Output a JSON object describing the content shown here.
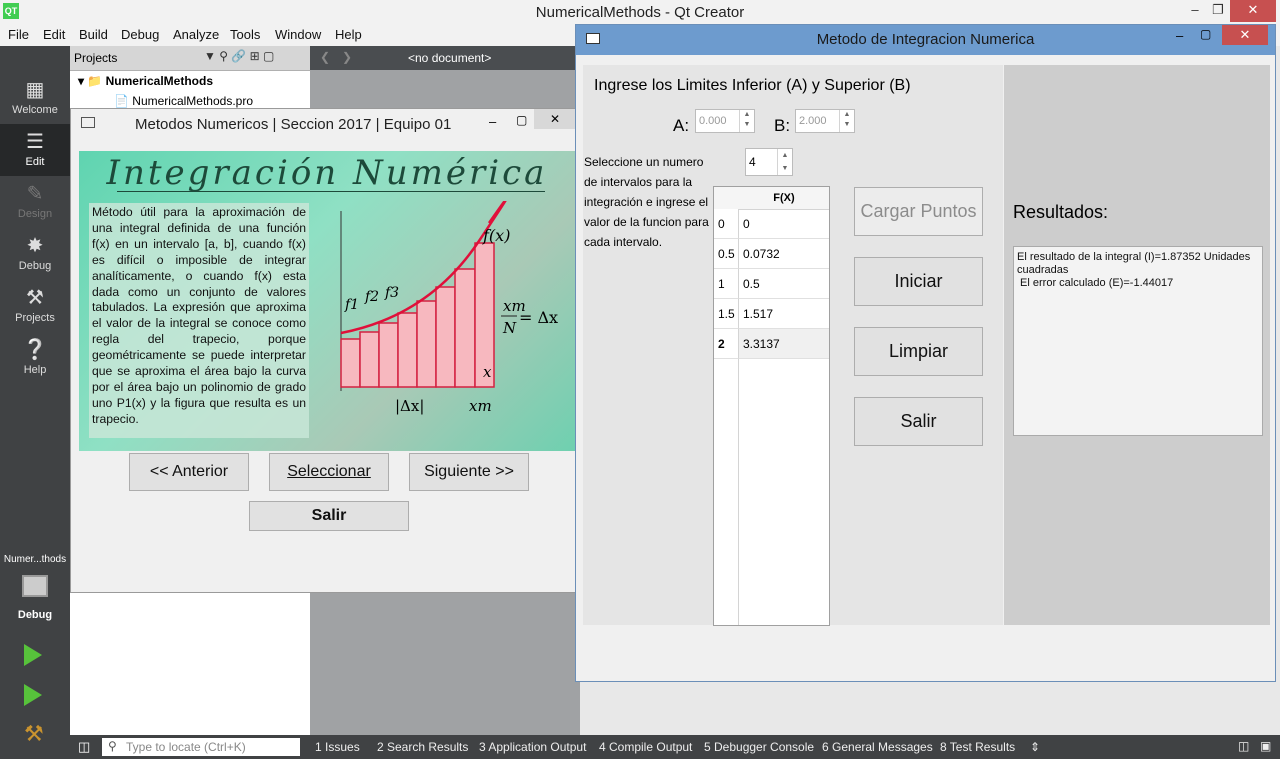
{
  "qt": {
    "title": "NumericalMethods - Qt Creator",
    "logo": "QT",
    "menu": [
      "File",
      "Edit",
      "Build",
      "Debug",
      "Analyze",
      "Tools",
      "Window",
      "Help"
    ],
    "modes": [
      "Welcome",
      "Edit",
      "Design",
      "Debug",
      "Projects",
      "Help"
    ],
    "run_target": "Numer...thods",
    "run_mode": "Debug",
    "projects_label": "Projects",
    "document": "<no document>",
    "tree": [
      "NumericalMethods",
      "NumericalMethods.pro"
    ],
    "locate_placeholder": "Type to locate (Ctrl+K)",
    "panes": [
      "1  Issues",
      "2  Search Results",
      "3  Application Output",
      "4  Compile Output",
      "5  Debugger Console",
      "6  General Messages",
      "8  Test Results"
    ]
  },
  "mn": {
    "title": "Metodos Numericos | Seccion 2017 | Equipo 01",
    "heading": "Integración Numérica",
    "description": "Método útil para la aproximación de una integral definida de una función f(x) en un intervalo [a, b], cuando f(x) es difícil o imposible de integrar analíticamente, o cuando f(x) esta dada como un conjunto de valores tabulados. La expresión que aproxima el valor de la integral se conoce como regla del trapecio, porque geométricamente se puede interpretar que se aproxima el área bajo la curva por el área bajo un polinomio de grado uno P1(x) y la figura que resulta es un trapecio.",
    "figure": {
      "fx": "f(x)",
      "f1": "f1",
      "f2": "f2",
      "f3": "f3",
      "formula_num": "xm",
      "formula_den": "N",
      "formula_rhs": "= Δx",
      "x_arrow": "x",
      "delta_x": "|Δx|",
      "xm": "xm"
    },
    "btn_prev": "<< Anterior",
    "btn_select": "Seleccionar",
    "btn_next": "Siguiente >>",
    "btn_exit": "Salir"
  },
  "mi": {
    "title": "Metodo de Integracion Numerica",
    "limits_label": "Ingrese los Limites Inferior (A) y Superior (B)",
    "a_label": "A:",
    "a_value": "0.000",
    "b_label": "B:",
    "b_value": "2.000",
    "intervals_text": "Seleccione un numero de intervalos para la integración e ingrese el valor de la funcion para cada intervalo.",
    "intervals_value": "4",
    "table_header": "F(X)",
    "rows": [
      {
        "x": "0",
        "fx": "0"
      },
      {
        "x": "0.5",
        "fx": "0.0732"
      },
      {
        "x": "1",
        "fx": "0.5"
      },
      {
        "x": "1.5",
        "fx": "1.517"
      },
      {
        "x": "2",
        "fx": "3.3137"
      }
    ],
    "btn_load": "Cargar Puntos",
    "btn_start": "Iniciar",
    "btn_clear": "Limpiar",
    "btn_exit": "Salir",
    "results_label": "Resultados:",
    "result_line1": "El resultado de la integral (I)=1.87352 Unidades cuadradas",
    "result_line2": " El error calculado (E)=-1.44017"
  }
}
